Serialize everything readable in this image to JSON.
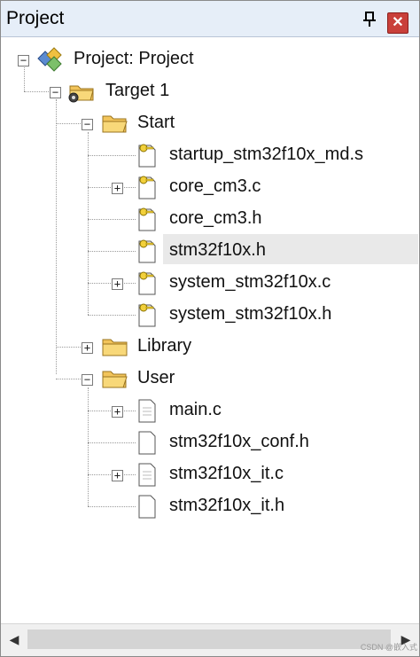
{
  "panel": {
    "title": "Project",
    "pin_icon": "pin-icon",
    "close_icon": "close-icon",
    "close_glyph": "✕"
  },
  "tree": {
    "root": {
      "label": "Project: Project",
      "icon": "project-icon",
      "expanded": true
    },
    "target": {
      "label": "Target 1",
      "icon": "target-folder-icon",
      "expanded": true
    },
    "groups": [
      {
        "label": "Start",
        "icon": "folder-open-icon",
        "expanded": true,
        "files": [
          {
            "label": "startup_stm32f10x_md.s",
            "icon": "file-key-icon",
            "expandable": false
          },
          {
            "label": "core_cm3.c",
            "icon": "file-key-icon",
            "expandable": true
          },
          {
            "label": "core_cm3.h",
            "icon": "file-key-icon",
            "expandable": false
          },
          {
            "label": "stm32f10x.h",
            "icon": "file-key-icon",
            "expandable": false,
            "selected": true
          },
          {
            "label": "system_stm32f10x.c",
            "icon": "file-key-icon",
            "expandable": true
          },
          {
            "label": "system_stm32f10x.h",
            "icon": "file-key-icon",
            "expandable": false
          }
        ]
      },
      {
        "label": "Library",
        "icon": "folder-closed-icon",
        "expanded": false,
        "files": []
      },
      {
        "label": "User",
        "icon": "folder-open-icon",
        "expanded": true,
        "files": [
          {
            "label": "main.c",
            "icon": "file-icon",
            "expandable": true
          },
          {
            "label": "stm32f10x_conf.h",
            "icon": "file-icon",
            "expandable": false
          },
          {
            "label": "stm32f10x_it.c",
            "icon": "file-icon",
            "expandable": true
          },
          {
            "label": "stm32f10x_it.h",
            "icon": "file-icon",
            "expandable": false
          }
        ]
      }
    ]
  },
  "scrollbar": {
    "left_glyph": "◀",
    "right_glyph": "▶"
  },
  "watermark": "CSDN @嵌入式"
}
